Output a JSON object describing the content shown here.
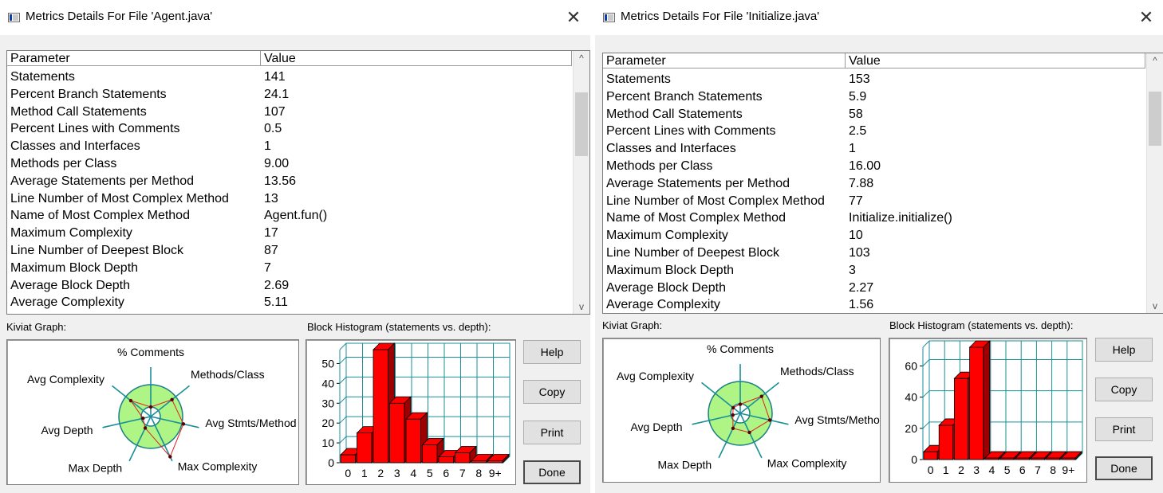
{
  "colors": {
    "window_bg": "#f0f0f0",
    "kiviat_fill": "#aef585",
    "kiviat_ring": "#1a7f86",
    "axis": "#1a8f98",
    "polygon": "#e02020",
    "bar": "#ff0000",
    "bar_dark": "#9c0000",
    "grid": "#1a8f98"
  },
  "icons": {
    "window": "metrics-window-icon",
    "close": "close-x-icon",
    "scroll_up": "chevron-up-icon",
    "scroll_down": "chevron-down-icon"
  },
  "kiviat_axes": [
    "% Comments",
    "Methods/Class",
    "Avg Stmts/Method",
    "Max Complexity",
    "Max Depth",
    "Avg Depth",
    "Avg Complexity"
  ],
  "dialogs": [
    {
      "title": "Metrics Details For File 'Agent.java'",
      "close_glyph": "✕",
      "table": {
        "headers": [
          "Parameter",
          "Value"
        ],
        "rows": [
          [
            "Statements",
            "141"
          ],
          [
            "Percent Branch Statements",
            "24.1"
          ],
          [
            "Method Call Statements",
            "107"
          ],
          [
            "Percent Lines with Comments",
            "0.5"
          ],
          [
            "Classes and Interfaces",
            "1"
          ],
          [
            "Methods per Class",
            "9.00"
          ],
          [
            "Average Statements per Method",
            "13.56"
          ],
          [
            "Line Number of Most Complex Method",
            "13"
          ],
          [
            "Name of Most Complex Method",
            "Agent.fun()"
          ],
          [
            "Maximum Complexity",
            "17"
          ],
          [
            "Line Number of Deepest Block",
            "87"
          ],
          [
            "Maximum Block Depth",
            "7"
          ],
          [
            "Average Block Depth",
            "2.69"
          ],
          [
            "Average Complexity",
            "5.11"
          ]
        ],
        "scroll_up": "^",
        "scroll_down": "v"
      },
      "kiviat": {
        "label": "Kiviat Graph:",
        "values": [
          0.3,
          0.85,
          1.05,
          1.4,
          0.4,
          0.25,
          0.8
        ]
      },
      "histogram": {
        "label": "Block Histogram (statements vs. depth):",
        "chart_data": {
          "type": "bar",
          "categories": [
            "0",
            "1",
            "2",
            "3",
            "4",
            "5",
            "6",
            "7",
            "8",
            "9+"
          ],
          "values": [
            4,
            15,
            57,
            30,
            22,
            9,
            3,
            5,
            1,
            1
          ],
          "ylim": [
            0,
            57
          ],
          "yticks": [
            0,
            10,
            20,
            30,
            40,
            50
          ],
          "grid": true
        }
      },
      "buttons": {
        "help": "Help",
        "copy": "Copy",
        "print": "Print",
        "done": "Done"
      }
    },
    {
      "title": "Metrics Details For File 'Initialize.java'",
      "close_glyph": "✕",
      "table": {
        "headers": [
          "Parameter",
          "Value"
        ],
        "rows": [
          [
            "Statements",
            "153"
          ],
          [
            "Percent Branch Statements",
            "5.9"
          ],
          [
            "Method Call Statements",
            "58"
          ],
          [
            "Percent Lines with Comments",
            "2.5"
          ],
          [
            "Classes and Interfaces",
            "1"
          ],
          [
            "Methods per Class",
            "16.00"
          ],
          [
            "Average Statements per Method",
            "7.88"
          ],
          [
            "Line Number of Most Complex Method",
            "77"
          ],
          [
            "Name of Most Complex Method",
            "Initialize.initialize()"
          ],
          [
            "Maximum Complexity",
            "10"
          ],
          [
            "Line Number of Deepest Block",
            "103"
          ],
          [
            "Maximum Block Depth",
            "3"
          ],
          [
            "Average Block Depth",
            "2.27"
          ],
          [
            "Average Complexity",
            "1.56"
          ]
        ],
        "scroll_up": "^",
        "scroll_down": "v"
      },
      "kiviat": {
        "label": "Kiviat Graph:",
        "values": [
          0.3,
          0.9,
          1.0,
          0.7,
          0.55,
          0.25,
          0.3
        ]
      },
      "histogram": {
        "label": "Block Histogram (statements vs. depth):",
        "chart_data": {
          "type": "bar",
          "categories": [
            "0",
            "1",
            "2",
            "3",
            "4",
            "5",
            "6",
            "7",
            "8",
            "9+"
          ],
          "values": [
            5,
            22,
            52,
            72,
            1,
            1,
            1,
            1,
            1,
            1
          ],
          "ylim": [
            0,
            72
          ],
          "yticks": [
            0,
            20,
            40,
            60
          ],
          "grid": true
        }
      },
      "buttons": {
        "help": "Help",
        "copy": "Copy",
        "print": "Print",
        "done": "Done"
      }
    }
  ]
}
